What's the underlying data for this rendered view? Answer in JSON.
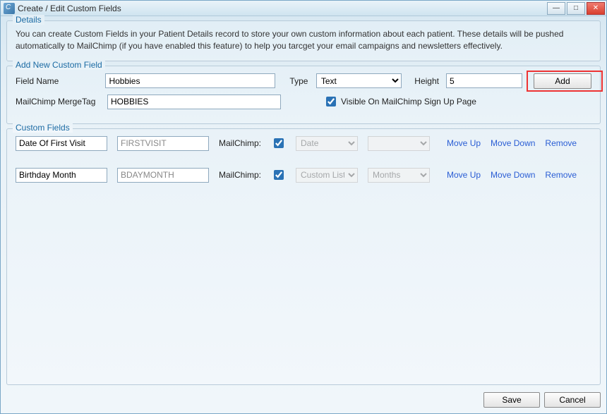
{
  "window": {
    "title": "Create / Edit Custom Fields"
  },
  "details": {
    "legend": "Details",
    "text": "You can create Custom Fields in your Patient Details record to store your own custom information about each patient.  These details will be pushed automatically to MailChimp (if you have enabled this feature) to help you tarcget your email campaigns and newsletters effectively."
  },
  "addNew": {
    "legend": "Add New Custom Field",
    "fieldNameLabel": "Field Name",
    "fieldNameValue": "Hobbies",
    "typeLabel": "Type",
    "typeValue": "Text",
    "heightLabel": "Height",
    "heightValue": "5",
    "addLabel": "Add",
    "mergeTagLabel": "MailChimp MergeTag",
    "mergeTagValue": "HOBBIES",
    "visibleLabel": "Visible On MailChimp Sign Up Page",
    "visibleChecked": true
  },
  "customFields": {
    "legend": "Custom Fields",
    "mailchimpLabel": "MailChimp:",
    "actions": {
      "moveUp": "Move Up",
      "moveDown": "Move Down",
      "remove": "Remove"
    },
    "rows": [
      {
        "name": "Date Of First Visit",
        "mergeTag": "FIRSTVISIT",
        "mcChecked": true,
        "type": "Date",
        "extra": ""
      },
      {
        "name": "Birthday Month",
        "mergeTag": "BDAYMONTH",
        "mcChecked": true,
        "type": "Custom List",
        "extra": "Months"
      }
    ]
  },
  "footer": {
    "save": "Save",
    "cancel": "Cancel"
  }
}
